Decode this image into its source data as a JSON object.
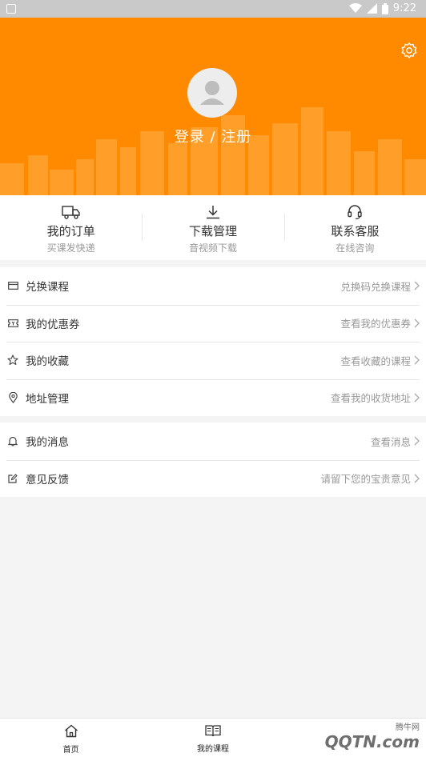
{
  "status_bar": {
    "time": "9:22"
  },
  "profile": {
    "login_label": "登录 / 注册"
  },
  "quick_actions": [
    {
      "title": "我的订单",
      "subtitle": "买课发快递",
      "icon": "truck-icon"
    },
    {
      "title": "下载管理",
      "subtitle": "音视频下载",
      "icon": "download-icon"
    },
    {
      "title": "联系客服",
      "subtitle": "在线咨询",
      "icon": "headset-icon"
    }
  ],
  "menu_group_1": [
    {
      "label": "兑换课程",
      "hint": "兑换码兑换课程",
      "icon": "card-icon"
    },
    {
      "label": "我的优惠券",
      "hint": "查看我的优惠券",
      "icon": "coupon-icon"
    },
    {
      "label": "我的收藏",
      "hint": "查看收藏的课程",
      "icon": "star-icon"
    },
    {
      "label": "地址管理",
      "hint": "查看我的收货地址",
      "icon": "location-icon"
    }
  ],
  "menu_group_2": [
    {
      "label": "我的消息",
      "hint": "查看消息",
      "icon": "bell-icon"
    },
    {
      "label": "意见反馈",
      "hint": "请留下您的宝贵意见",
      "icon": "edit-icon"
    }
  ],
  "tabs": [
    {
      "label": "首页",
      "icon": "home-icon"
    },
    {
      "label": "我的课程",
      "icon": "book-icon"
    }
  ],
  "watermark": {
    "text": "QQTN.com",
    "sub": "腾牛网"
  },
  "colors": {
    "accent": "#ff8a00",
    "background": "#f4f4f4"
  }
}
